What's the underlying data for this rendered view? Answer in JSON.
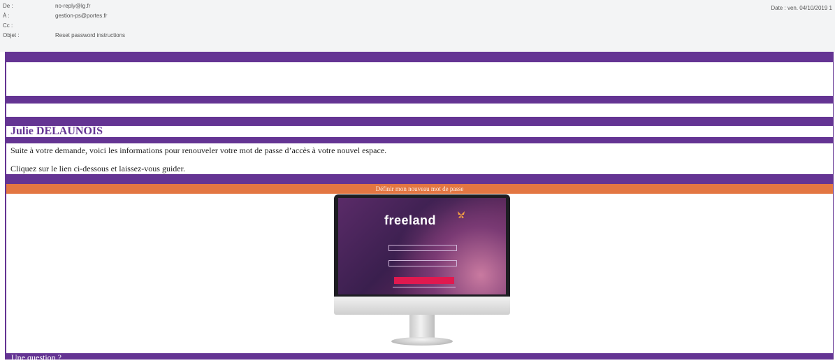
{
  "email_header": {
    "from_label": "De :",
    "from_value": "no-reply@lg.fr",
    "to_label": "À :",
    "to_value": "gestion-ps@portes.fr",
    "cc_label": "Cc :",
    "cc_value": "",
    "subject_label": "Objet :",
    "subject_value": "Reset password instructions",
    "date_label": "Date :",
    "date_value": "ven. 04/10/2019 1"
  },
  "body": {
    "recipient_name": "Julie DELAUNOIS",
    "line1": "Suite à votre demande, voici les informations pour renouveler votre mot de passe d’accès à votre nouvel espace.",
    "line2": "Cliquez sur le lien ci-dessous et laissez-vous guider.",
    "cta_label": "Définir mon nouveau mot de passe",
    "footer_question": "Une question ?"
  },
  "hero": {
    "logo_text": "freeland",
    "logo_icon": "butterfly-icon"
  },
  "colors": {
    "frame_purple": "#643493",
    "cta_orange": "#e37642",
    "header_bg": "#f3f4f5"
  }
}
